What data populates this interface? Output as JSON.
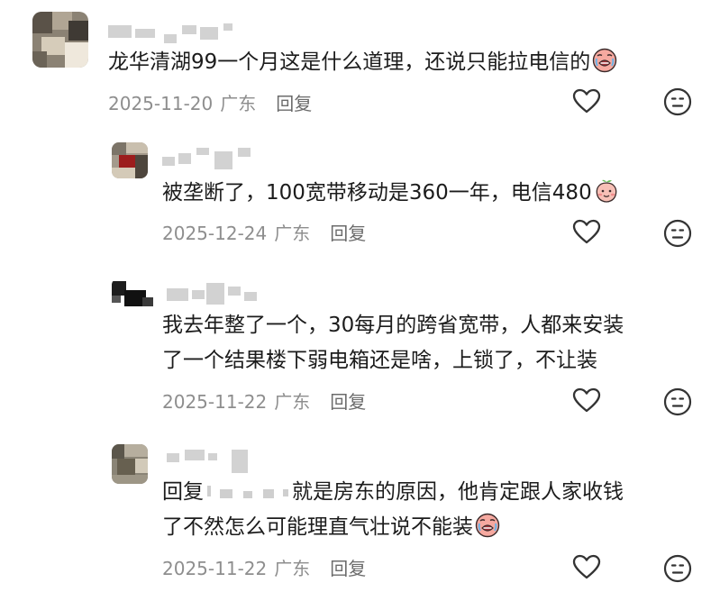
{
  "comments": [
    {
      "text": "龙华清湖99一个月这是什么道理，还说只能拉电信的",
      "date": "2025-11-20",
      "location": "广东",
      "reply": "回复",
      "emoji": "sob-face-icon"
    },
    {
      "text": "被垄断了，100宽带移动是360一年，电信480",
      "date": "2025-12-24",
      "location": "广东",
      "reply": "回复",
      "emoji": "peach-face-icon"
    },
    {
      "line1": "我去年整了一个，30每月的跨省宽带，人都来安装",
      "line2": "了一个结果楼下弱电箱还是啥，上锁了，不让装",
      "date": "2025-11-22",
      "location": "广东",
      "reply": "回复"
    },
    {
      "prefix": "回复",
      "line1_rest": "就是房东的原因，他肯定跟人家收钱",
      "line2": "了不然怎么可能理直气壮说不能装",
      "date": "2025-11-22",
      "location": "广东",
      "reply": "回复",
      "emoji": "sob-face-icon"
    }
  ],
  "icons": {
    "like": "heart-outline-icon",
    "react": "neutral-face-icon"
  },
  "colors": {
    "text": "#1c1c1c",
    "meta": "#8e8e8e",
    "icon": "#333333"
  }
}
